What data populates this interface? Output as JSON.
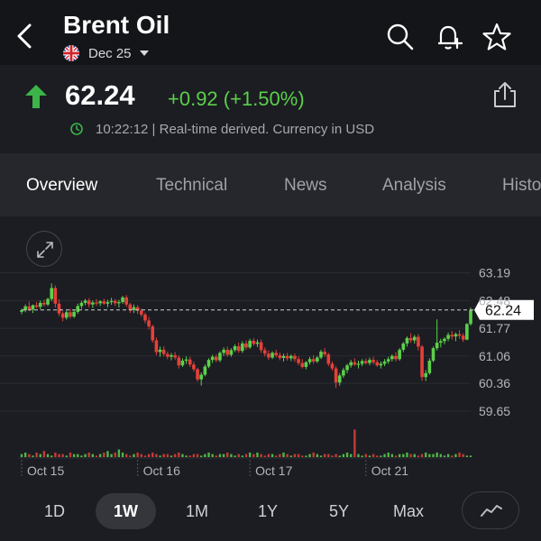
{
  "header": {
    "title": "Brent Oil",
    "contract": "Dec 25"
  },
  "quote": {
    "price": "62.24",
    "change": "+0.92 (+1.50%)",
    "meta": "10:22:12 | Real-time derived. Currency in USD"
  },
  "tabs": [
    "Overview",
    "Technical",
    "News",
    "Analysis",
    "History"
  ],
  "ranges": [
    "1D",
    "1W",
    "1M",
    "1Y",
    "5Y",
    "Max"
  ],
  "active_range": "1W",
  "colors": {
    "up": "#5bd04a",
    "down": "#e5403a",
    "background": "#1b1d22",
    "tab_bar": "#25272c",
    "top_bar": "#141518"
  },
  "chart_data": {
    "type": "candlestick",
    "y_ticks": [
      "63.19",
      "62.48",
      "61.77",
      "61.06",
      "60.36",
      "59.65"
    ],
    "y_tick_values": [
      63.19,
      62.48,
      61.77,
      61.06,
      60.36,
      59.65
    ],
    "ylim": [
      59.3,
      63.55
    ],
    "x_ticks": [
      "Oct 15",
      "Oct 16",
      "Oct 17",
      "Oct 21"
    ],
    "x_tick_index": [
      0,
      31,
      61,
      92
    ],
    "last_price_label": "62.24",
    "last_price": 62.24,
    "candles": [
      [
        62.19,
        62.27,
        62.13,
        62.23
      ],
      [
        62.23,
        62.38,
        62.18,
        62.33
      ],
      [
        62.33,
        62.45,
        62.21,
        62.25
      ],
      [
        62.25,
        62.38,
        62.16,
        62.36
      ],
      [
        62.36,
        62.44,
        62.28,
        62.32
      ],
      [
        62.32,
        62.48,
        62.25,
        62.42
      ],
      [
        62.42,
        62.5,
        62.33,
        62.38
      ],
      [
        62.38,
        62.55,
        62.34,
        62.52
      ],
      [
        62.52,
        62.92,
        62.46,
        62.8
      ],
      [
        62.8,
        62.87,
        62.3,
        62.4
      ],
      [
        62.4,
        62.51,
        62.08,
        62.15
      ],
      [
        62.15,
        62.2,
        61.95,
        62.04
      ],
      [
        62.04,
        62.22,
        61.99,
        62.18
      ],
      [
        62.18,
        62.27,
        62.02,
        62.07
      ],
      [
        62.07,
        62.24,
        62.03,
        62.19
      ],
      [
        62.19,
        62.4,
        62.14,
        62.34
      ],
      [
        62.34,
        62.47,
        62.27,
        62.42
      ],
      [
        62.42,
        62.52,
        62.36,
        62.48
      ],
      [
        62.48,
        62.54,
        62.31,
        62.38
      ],
      [
        62.38,
        62.48,
        62.29,
        62.43
      ],
      [
        62.43,
        62.52,
        62.35,
        62.41
      ],
      [
        62.41,
        62.49,
        62.34,
        62.46
      ],
      [
        62.46,
        62.53,
        62.37,
        62.4
      ],
      [
        62.4,
        62.5,
        62.31,
        62.44
      ],
      [
        62.44,
        62.55,
        62.37,
        62.47
      ],
      [
        62.47,
        62.52,
        62.34,
        62.41
      ],
      [
        62.41,
        62.5,
        62.3,
        62.44
      ],
      [
        62.44,
        62.6,
        62.4,
        62.56
      ],
      [
        62.56,
        62.62,
        62.32,
        62.38
      ],
      [
        62.38,
        62.42,
        62.16,
        62.24
      ],
      [
        62.24,
        62.38,
        62.16,
        62.31
      ],
      [
        62.31,
        62.36,
        62.14,
        62.22
      ],
      [
        62.22,
        62.28,
        62.06,
        62.12
      ],
      [
        62.12,
        62.17,
        61.9,
        61.97
      ],
      [
        61.97,
        62.06,
        61.74,
        61.82
      ],
      [
        61.82,
        61.86,
        61.4,
        61.46
      ],
      [
        61.46,
        61.53,
        61.08,
        61.16
      ],
      [
        61.16,
        61.3,
        61.04,
        61.22
      ],
      [
        61.22,
        61.31,
        61.05,
        61.11
      ],
      [
        61.11,
        61.17,
        60.98,
        61.04
      ],
      [
        61.04,
        61.14,
        60.95,
        61.08
      ],
      [
        61.08,
        61.16,
        60.96,
        61.02
      ],
      [
        61.02,
        61.08,
        60.74,
        60.82
      ],
      [
        60.82,
        61.0,
        60.78,
        60.94
      ],
      [
        60.94,
        61.05,
        60.86,
        60.97
      ],
      [
        60.97,
        61.04,
        60.78,
        60.84
      ],
      [
        60.84,
        60.91,
        60.66,
        60.72
      ],
      [
        60.72,
        60.76,
        60.4,
        60.46
      ],
      [
        60.46,
        60.64,
        60.3,
        60.58
      ],
      [
        60.58,
        60.84,
        60.54,
        60.79
      ],
      [
        60.79,
        61.0,
        60.75,
        60.96
      ],
      [
        60.96,
        61.09,
        60.88,
        61.04
      ],
      [
        61.04,
        61.1,
        60.9,
        60.95
      ],
      [
        60.95,
        61.18,
        60.9,
        61.14
      ],
      [
        61.14,
        61.28,
        61.06,
        61.22
      ],
      [
        61.22,
        61.3,
        61.04,
        61.09
      ],
      [
        61.09,
        61.26,
        61.04,
        61.21
      ],
      [
        61.21,
        61.36,
        61.16,
        61.31
      ],
      [
        61.31,
        61.4,
        61.14,
        61.19
      ],
      [
        61.19,
        61.44,
        61.14,
        61.38
      ],
      [
        61.38,
        61.46,
        61.22,
        61.28
      ],
      [
        61.28,
        61.5,
        61.24,
        61.45
      ],
      [
        61.45,
        61.52,
        61.32,
        61.37
      ],
      [
        61.37,
        61.48,
        61.29,
        61.41
      ],
      [
        61.41,
        61.48,
        61.14,
        61.21
      ],
      [
        61.21,
        61.28,
        61.05,
        61.12
      ],
      [
        61.12,
        61.2,
        60.96,
        61.02
      ],
      [
        61.02,
        61.18,
        60.98,
        61.14
      ],
      [
        61.14,
        61.22,
        61.02,
        61.08
      ],
      [
        61.08,
        61.15,
        60.95,
        61.01
      ],
      [
        61.01,
        61.12,
        60.92,
        61.06
      ],
      [
        61.06,
        61.14,
        60.94,
        61.0
      ],
      [
        61.0,
        61.1,
        60.93,
        61.06
      ],
      [
        61.06,
        61.12,
        60.91,
        60.98
      ],
      [
        60.98,
        61.05,
        60.82,
        60.88
      ],
      [
        60.88,
        60.98,
        60.74,
        60.78
      ],
      [
        60.78,
        60.93,
        60.72,
        60.9
      ],
      [
        60.9,
        61.04,
        60.84,
        60.98
      ],
      [
        60.98,
        61.08,
        60.86,
        60.92
      ],
      [
        60.92,
        61.06,
        60.88,
        61.02
      ],
      [
        61.02,
        61.22,
        60.98,
        61.17
      ],
      [
        61.17,
        61.26,
        61.04,
        61.1
      ],
      [
        61.1,
        61.14,
        60.8,
        60.86
      ],
      [
        60.86,
        60.92,
        60.68,
        60.74
      ],
      [
        60.74,
        60.8,
        60.24,
        60.38
      ],
      [
        60.38,
        60.62,
        60.3,
        60.56
      ],
      [
        60.56,
        60.76,
        60.5,
        60.7
      ],
      [
        60.7,
        60.86,
        60.62,
        60.82
      ],
      [
        60.82,
        60.96,
        60.76,
        60.9
      ],
      [
        60.9,
        61.0,
        60.8,
        60.84
      ],
      [
        60.84,
        60.94,
        60.74,
        60.86
      ],
      [
        60.86,
        60.98,
        60.8,
        60.93
      ],
      [
        60.93,
        61.0,
        60.84,
        60.88
      ],
      [
        60.88,
        61.02,
        60.82,
        60.96
      ],
      [
        60.96,
        61.04,
        60.84,
        60.9
      ],
      [
        60.9,
        60.96,
        60.78,
        60.82
      ],
      [
        60.82,
        60.92,
        60.74,
        60.86
      ],
      [
        60.86,
        60.98,
        60.8,
        60.92
      ],
      [
        60.92,
        61.04,
        60.86,
        60.98
      ],
      [
        60.98,
        61.1,
        60.92,
        61.06
      ],
      [
        61.06,
        61.16,
        60.92,
        60.98
      ],
      [
        60.98,
        61.26,
        60.94,
        61.22
      ],
      [
        61.22,
        61.42,
        61.16,
        61.38
      ],
      [
        61.38,
        61.56,
        61.3,
        61.52
      ],
      [
        61.52,
        61.64,
        61.4,
        61.46
      ],
      [
        61.46,
        61.6,
        61.38,
        61.55
      ],
      [
        61.55,
        61.62,
        61.2,
        61.3
      ],
      [
        61.3,
        61.34,
        60.42,
        60.52
      ],
      [
        60.52,
        60.7,
        60.42,
        60.62
      ],
      [
        60.62,
        61.0,
        60.58,
        60.94
      ],
      [
        60.94,
        61.3,
        60.9,
        61.26
      ],
      [
        61.26,
        62.0,
        61.2,
        61.4
      ],
      [
        61.4,
        61.5,
        61.28,
        61.44
      ],
      [
        61.44,
        61.54,
        61.36,
        61.5
      ],
      [
        61.5,
        61.66,
        61.44,
        61.6
      ],
      [
        61.6,
        61.7,
        61.48,
        61.56
      ],
      [
        61.56,
        61.66,
        61.44,
        61.62
      ],
      [
        61.62,
        61.72,
        61.5,
        61.58
      ],
      [
        61.58,
        61.64,
        61.42,
        61.48
      ],
      [
        61.48,
        61.9,
        61.46,
        61.88
      ],
      [
        61.88,
        62.3,
        61.84,
        62.24
      ]
    ],
    "volume": [
      2,
      3,
      2,
      1,
      3,
      2,
      4,
      2,
      1,
      3,
      2,
      2,
      1,
      3,
      2,
      2,
      1,
      2,
      3,
      2,
      1,
      2,
      3,
      4,
      2,
      3,
      5,
      3,
      2,
      1,
      2,
      3,
      2,
      1,
      2,
      3,
      2,
      1,
      2,
      2,
      1,
      2,
      3,
      2,
      1,
      1,
      2,
      2,
      1,
      2,
      3,
      2,
      1,
      2,
      2,
      3,
      2,
      1,
      2,
      1,
      2,
      3,
      2,
      3,
      2,
      1,
      2,
      2,
      1,
      2,
      3,
      2,
      1,
      2,
      2,
      1,
      1,
      2,
      3,
      2,
      1,
      2,
      2,
      1,
      2,
      1,
      2,
      3,
      2,
      18,
      2,
      1,
      2,
      1,
      2,
      1,
      1,
      2,
      3,
      2,
      1,
      2,
      2,
      3,
      2,
      2,
      1,
      2,
      3,
      2,
      2,
      3,
      2,
      1,
      2,
      1,
      2,
      3,
      2,
      1,
      1,
      2,
      2,
      1
    ]
  }
}
